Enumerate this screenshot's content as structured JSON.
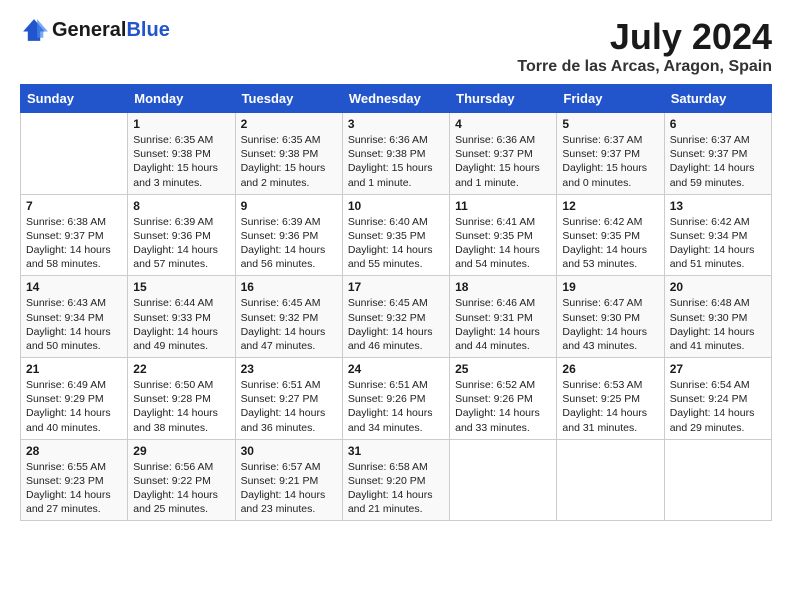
{
  "header": {
    "logo_general": "General",
    "logo_blue": "Blue",
    "title": "July 2024",
    "subtitle": "Torre de las Arcas, Aragon, Spain"
  },
  "weekdays": [
    "Sunday",
    "Monday",
    "Tuesday",
    "Wednesday",
    "Thursday",
    "Friday",
    "Saturday"
  ],
  "weeks": [
    [
      {
        "day": "",
        "info": ""
      },
      {
        "day": "1",
        "info": "Sunrise: 6:35 AM\nSunset: 9:38 PM\nDaylight: 15 hours\nand 3 minutes."
      },
      {
        "day": "2",
        "info": "Sunrise: 6:35 AM\nSunset: 9:38 PM\nDaylight: 15 hours\nand 2 minutes."
      },
      {
        "day": "3",
        "info": "Sunrise: 6:36 AM\nSunset: 9:38 PM\nDaylight: 15 hours\nand 1 minute."
      },
      {
        "day": "4",
        "info": "Sunrise: 6:36 AM\nSunset: 9:37 PM\nDaylight: 15 hours\nand 1 minute."
      },
      {
        "day": "5",
        "info": "Sunrise: 6:37 AM\nSunset: 9:37 PM\nDaylight: 15 hours\nand 0 minutes."
      },
      {
        "day": "6",
        "info": "Sunrise: 6:37 AM\nSunset: 9:37 PM\nDaylight: 14 hours\nand 59 minutes."
      }
    ],
    [
      {
        "day": "7",
        "info": "Sunrise: 6:38 AM\nSunset: 9:37 PM\nDaylight: 14 hours\nand 58 minutes."
      },
      {
        "day": "8",
        "info": "Sunrise: 6:39 AM\nSunset: 9:36 PM\nDaylight: 14 hours\nand 57 minutes."
      },
      {
        "day": "9",
        "info": "Sunrise: 6:39 AM\nSunset: 9:36 PM\nDaylight: 14 hours\nand 56 minutes."
      },
      {
        "day": "10",
        "info": "Sunrise: 6:40 AM\nSunset: 9:35 PM\nDaylight: 14 hours\nand 55 minutes."
      },
      {
        "day": "11",
        "info": "Sunrise: 6:41 AM\nSunset: 9:35 PM\nDaylight: 14 hours\nand 54 minutes."
      },
      {
        "day": "12",
        "info": "Sunrise: 6:42 AM\nSunset: 9:35 PM\nDaylight: 14 hours\nand 53 minutes."
      },
      {
        "day": "13",
        "info": "Sunrise: 6:42 AM\nSunset: 9:34 PM\nDaylight: 14 hours\nand 51 minutes."
      }
    ],
    [
      {
        "day": "14",
        "info": "Sunrise: 6:43 AM\nSunset: 9:34 PM\nDaylight: 14 hours\nand 50 minutes."
      },
      {
        "day": "15",
        "info": "Sunrise: 6:44 AM\nSunset: 9:33 PM\nDaylight: 14 hours\nand 49 minutes."
      },
      {
        "day": "16",
        "info": "Sunrise: 6:45 AM\nSunset: 9:32 PM\nDaylight: 14 hours\nand 47 minutes."
      },
      {
        "day": "17",
        "info": "Sunrise: 6:45 AM\nSunset: 9:32 PM\nDaylight: 14 hours\nand 46 minutes."
      },
      {
        "day": "18",
        "info": "Sunrise: 6:46 AM\nSunset: 9:31 PM\nDaylight: 14 hours\nand 44 minutes."
      },
      {
        "day": "19",
        "info": "Sunrise: 6:47 AM\nSunset: 9:30 PM\nDaylight: 14 hours\nand 43 minutes."
      },
      {
        "day": "20",
        "info": "Sunrise: 6:48 AM\nSunset: 9:30 PM\nDaylight: 14 hours\nand 41 minutes."
      }
    ],
    [
      {
        "day": "21",
        "info": "Sunrise: 6:49 AM\nSunset: 9:29 PM\nDaylight: 14 hours\nand 40 minutes."
      },
      {
        "day": "22",
        "info": "Sunrise: 6:50 AM\nSunset: 9:28 PM\nDaylight: 14 hours\nand 38 minutes."
      },
      {
        "day": "23",
        "info": "Sunrise: 6:51 AM\nSunset: 9:27 PM\nDaylight: 14 hours\nand 36 minutes."
      },
      {
        "day": "24",
        "info": "Sunrise: 6:51 AM\nSunset: 9:26 PM\nDaylight: 14 hours\nand 34 minutes."
      },
      {
        "day": "25",
        "info": "Sunrise: 6:52 AM\nSunset: 9:26 PM\nDaylight: 14 hours\nand 33 minutes."
      },
      {
        "day": "26",
        "info": "Sunrise: 6:53 AM\nSunset: 9:25 PM\nDaylight: 14 hours\nand 31 minutes."
      },
      {
        "day": "27",
        "info": "Sunrise: 6:54 AM\nSunset: 9:24 PM\nDaylight: 14 hours\nand 29 minutes."
      }
    ],
    [
      {
        "day": "28",
        "info": "Sunrise: 6:55 AM\nSunset: 9:23 PM\nDaylight: 14 hours\nand 27 minutes."
      },
      {
        "day": "29",
        "info": "Sunrise: 6:56 AM\nSunset: 9:22 PM\nDaylight: 14 hours\nand 25 minutes."
      },
      {
        "day": "30",
        "info": "Sunrise: 6:57 AM\nSunset: 9:21 PM\nDaylight: 14 hours\nand 23 minutes."
      },
      {
        "day": "31",
        "info": "Sunrise: 6:58 AM\nSunset: 9:20 PM\nDaylight: 14 hours\nand 21 minutes."
      },
      {
        "day": "",
        "info": ""
      },
      {
        "day": "",
        "info": ""
      },
      {
        "day": "",
        "info": ""
      }
    ]
  ]
}
